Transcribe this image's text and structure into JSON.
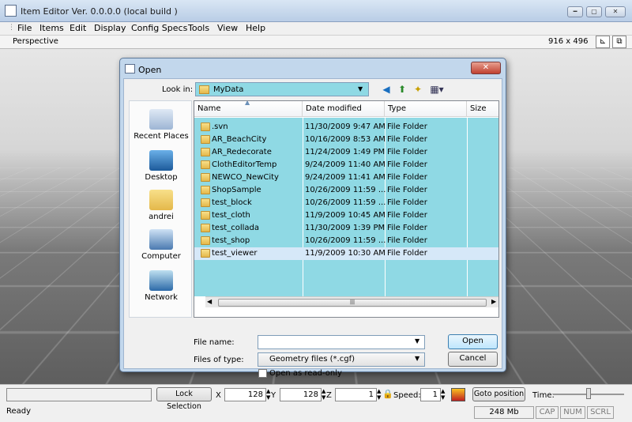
{
  "app": {
    "title": "Item Editor Ver. 0.0.0.0 (local build )"
  },
  "menu": [
    "File",
    "Items",
    "Edit",
    "Display",
    "Config Specs",
    "Tools",
    "View",
    "Help"
  ],
  "viewport": {
    "mode": "Perspective",
    "size": "916 x 496"
  },
  "dialog": {
    "title": "Open",
    "close": "✕",
    "look_in_label": "Look in:",
    "look_in_value": "MyData",
    "places": [
      "Recent Places",
      "Desktop",
      "andrei",
      "Computer",
      "Network"
    ],
    "columns": [
      "Name",
      "Date modified",
      "Type",
      "Size"
    ],
    "files": [
      {
        "name": ".svn",
        "date": "11/30/2009 9:47 AM",
        "type": "File Folder"
      },
      {
        "name": "AR_BeachCity",
        "date": "10/16/2009 8:53 AM",
        "type": "File Folder"
      },
      {
        "name": "AR_Redecorate",
        "date": "11/24/2009 1:49 PM",
        "type": "File Folder"
      },
      {
        "name": "ClothEditorTemp",
        "date": "9/24/2009 11:40 AM",
        "type": "File Folder"
      },
      {
        "name": "NEWCO_NewCity",
        "date": "9/24/2009 11:41 AM",
        "type": "File Folder"
      },
      {
        "name": "ShopSample",
        "date": "10/26/2009 11:59 ...",
        "type": "File Folder"
      },
      {
        "name": "test_block",
        "date": "10/26/2009 11:59 ...",
        "type": "File Folder"
      },
      {
        "name": "test_cloth",
        "date": "11/9/2009 10:45 AM",
        "type": "File Folder"
      },
      {
        "name": "test_collada",
        "date": "11/30/2009 1:39 PM",
        "type": "File Folder"
      },
      {
        "name": "test_shop",
        "date": "10/26/2009 11:59 ...",
        "type": "File Folder"
      },
      {
        "name": "test_viewer",
        "date": "11/9/2009 10:30 AM",
        "type": "File Folder"
      }
    ],
    "file_name_label": "File name:",
    "file_name_value": "",
    "file_type_label": "Files of type:",
    "file_type_value": "Geometry files (*.cgf)",
    "readonly_label": "Open as read-only",
    "open_label": "Open",
    "cancel_label": "Cancel"
  },
  "toolbar": {
    "lock_selection": "Lock Selection",
    "x_label": "X",
    "x_value": "128",
    "y_label": "Y",
    "y_value": "128",
    "z_label": "Z",
    "z_value": "1",
    "speed_label": "Speed:",
    "speed_value": "1",
    "goto_label": "Goto position",
    "time_label": "Time:"
  },
  "status": {
    "ready": "Ready",
    "memory": "248 Mb",
    "cap": "CAP",
    "num": "NUM",
    "scrl": "SCRL"
  }
}
